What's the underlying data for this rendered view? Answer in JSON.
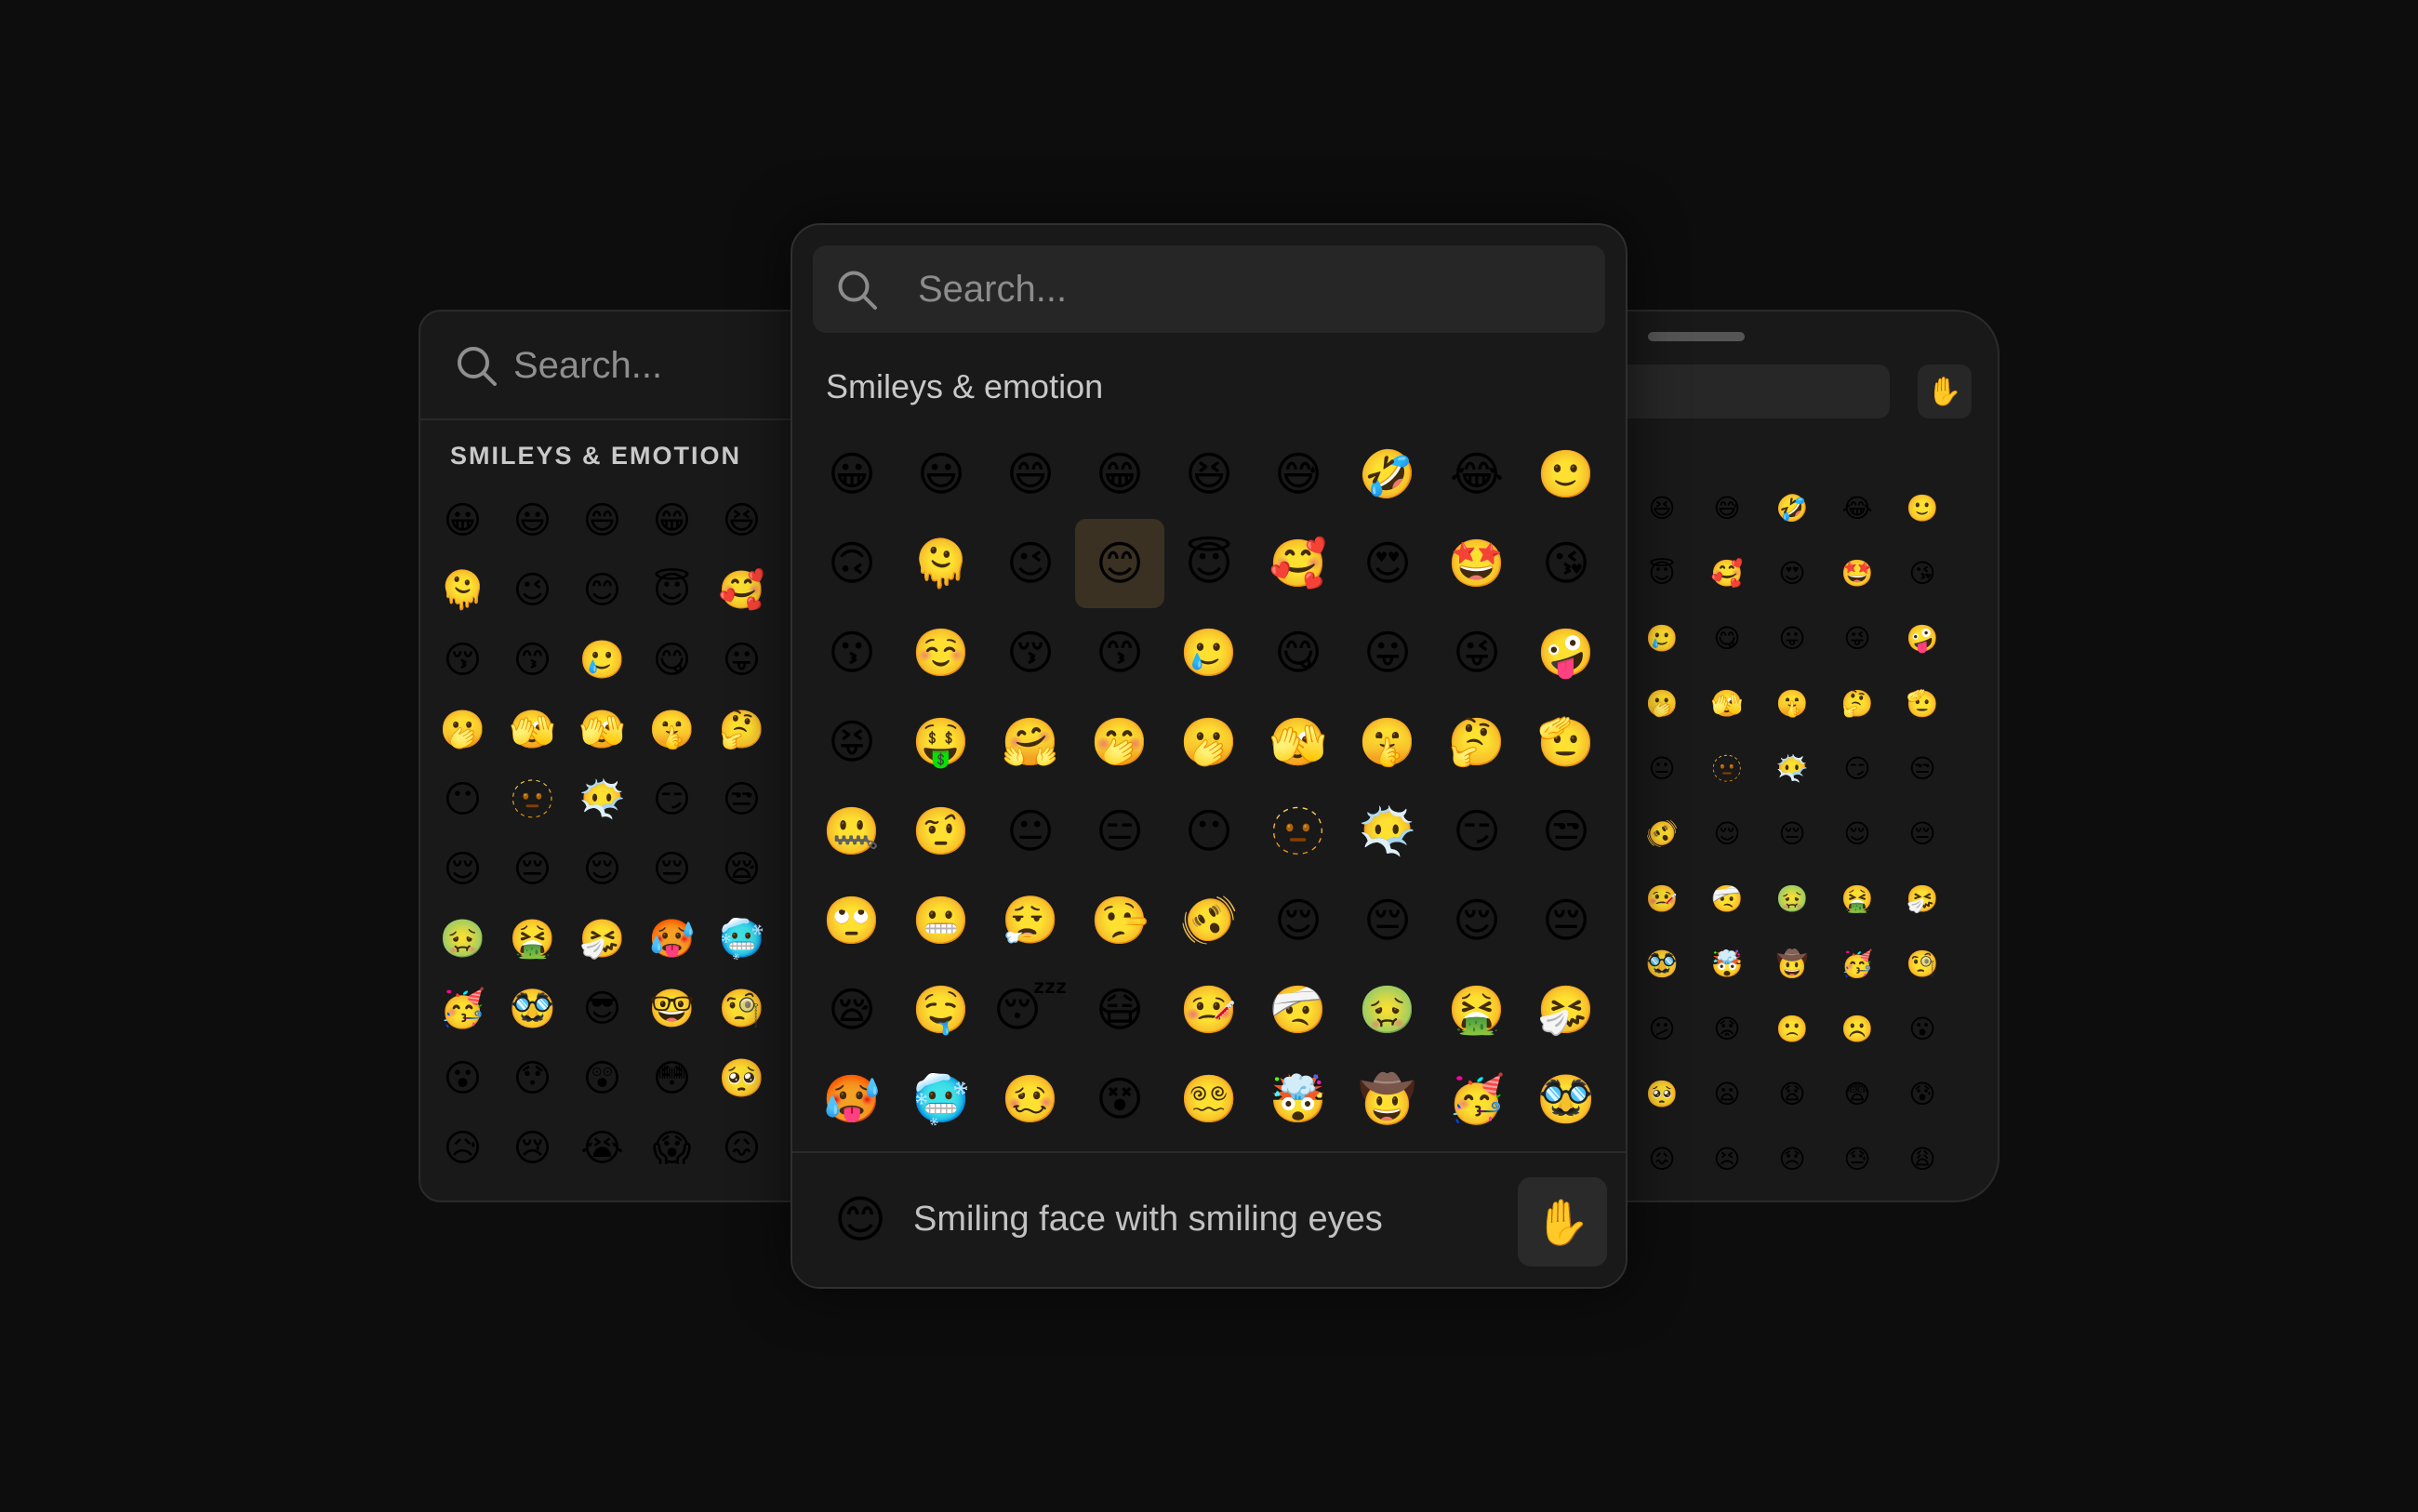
{
  "left_panel": {
    "search": {
      "placeholder": "Search..."
    },
    "section_title": "SMILEYS & EMOTION",
    "emojis": [
      "😀",
      "😃",
      "😄",
      "😁",
      "😆",
      "🫠",
      "😉",
      "😊",
      "😇",
      "🥰",
      "😚",
      "😙",
      "🥲",
      "😋",
      "😛",
      "🫢",
      "🫣",
      "🫣",
      "🤫",
      "🤔",
      "😶",
      "🫥",
      "😶‍🌫️",
      "😏",
      "😒",
      "😌",
      "😔",
      "😌",
      "😔",
      "😪",
      "🤢",
      "🤮",
      "🤧",
      "🥵",
      "🥶",
      "🥳",
      "🥸",
      "😎",
      "🤓",
      "🧐",
      "😮",
      "😯",
      "😲",
      "😳",
      "🥺",
      "😥",
      "😢",
      "😭",
      "😱",
      "😖"
    ]
  },
  "center_panel": {
    "search": {
      "placeholder": "Search..."
    },
    "section_title": "Smileys & emotion",
    "emojis": [
      "😀",
      "😃",
      "😄",
      "😁",
      "😆",
      "😅",
      "🤣",
      "😂",
      "🙂",
      "🙃",
      "🫠",
      "😉",
      "😊",
      "😇",
      "🥰",
      "😍",
      "🤩",
      "😘",
      "😗",
      "☺️",
      "😚",
      "😙",
      "🥲",
      "😋",
      "😛",
      "😜",
      "🤪",
      "😝",
      "🤑",
      "🤗",
      "🤭",
      "🫢",
      "🫣",
      "🤫",
      "🤔",
      "🫡",
      "🤐",
      "🤨",
      "😐",
      "😑",
      "😶",
      "🫥",
      "😶‍🌫️",
      "😏",
      "😒",
      "🙄",
      "😬",
      "😮‍💨",
      "🤥",
      "🫨",
      "😌",
      "😔",
      "😌",
      "😔",
      "😪",
      "🤤",
      "😴",
      "😷",
      "🤒",
      "🤕",
      "🤢",
      "🤮",
      "🤧",
      "🥵",
      "🥶",
      "🥴",
      "😵",
      "😵‍💫",
      "🤯",
      "🤠",
      "🥳",
      "🥸"
    ],
    "selected_index": 12,
    "footer": {
      "selected_emoji": "😊",
      "selected_name": "Smiling face with smiling eyes",
      "skin_tone": "✋"
    }
  },
  "right_panel": {
    "skin_tone": "✋",
    "emojis": [
      "😄",
      "😆",
      "😅",
      "🤣",
      "😂",
      "🙂",
      "😊",
      "😇",
      "🥰",
      "😍",
      "🤩",
      "😘",
      "🥲",
      "🥲",
      "😋",
      "😛",
      "😜",
      "🤪",
      "🤭",
      "🫢",
      "🫣",
      "🤫",
      "🤔",
      "🫡",
      "😶",
      "😐",
      "🫥",
      "😶‍🌫️",
      "😏",
      "😒",
      "🤥",
      "🫨",
      "😌",
      "😔",
      "😌",
      "😔",
      "🤒",
      "🤒",
      "🤕",
      "🤢",
      "🤮",
      "🤧",
      "🥸",
      "🥸",
      "🤯",
      "🤠",
      "🥳",
      "🧐",
      "😕",
      "😕",
      "😟",
      "🙁",
      "☹️",
      "😮",
      "🥺",
      "🥺",
      "😦",
      "😧",
      "😨",
      "😰",
      "😱",
      "😖",
      "😣",
      "😞",
      "😓",
      "😩"
    ]
  }
}
